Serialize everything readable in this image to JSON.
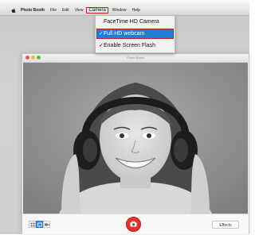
{
  "menubar": {
    "app_name": "Photo Booth",
    "items": [
      "File",
      "Edit",
      "View",
      "Camera",
      "Window",
      "Help"
    ],
    "active_item": "Camera"
  },
  "camera_menu": {
    "items": [
      {
        "label": "FaceTime HD Camera",
        "checked": false,
        "selected": false
      },
      {
        "label": "Full HD webcam",
        "checked": true,
        "selected": true
      },
      {
        "label": "Enable Screen Flash",
        "checked": true,
        "selected": false
      }
    ],
    "check_glyph": "✓",
    "highlight_color": "#1f7ed6",
    "callout_color": "#c81d1d"
  },
  "window": {
    "title": "Photo Booth",
    "traffic_lights": [
      "#ee5a4f",
      "#f2bc3a",
      "#5dc141"
    ]
  },
  "viewport": {
    "content": "camera-preview-photo"
  },
  "toolbar": {
    "mode_icons": [
      "multi-shot-icon",
      "single-photo-icon",
      "video-icon"
    ],
    "selected_mode": 1,
    "shutter_icon": "camera-icon",
    "effects_label": "Effects",
    "shutter_color": "#e0332a"
  }
}
